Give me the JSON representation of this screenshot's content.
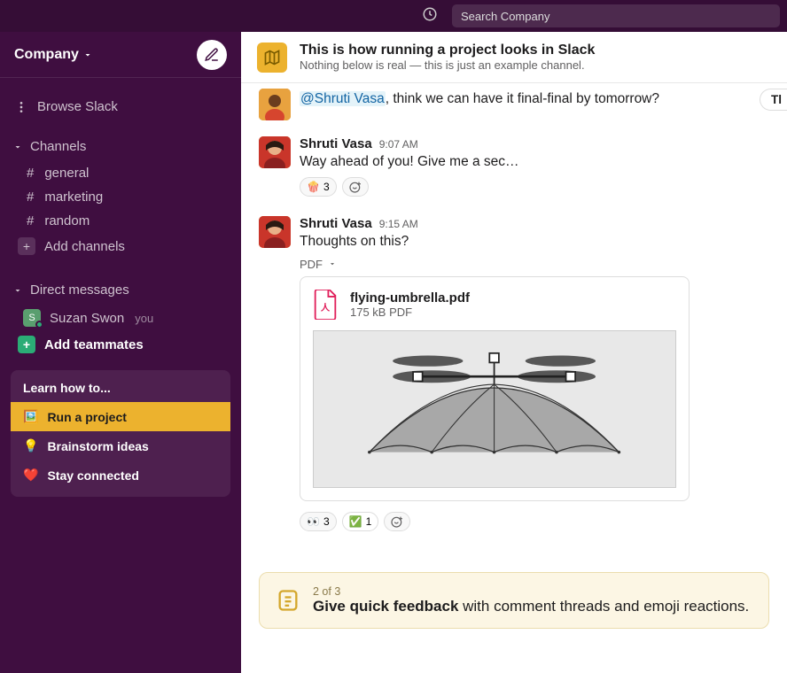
{
  "search": {
    "placeholder": "Search Company"
  },
  "workspace": {
    "name": "Company"
  },
  "sidebar": {
    "browse": "Browse Slack",
    "channels_header": "Channels",
    "channels": [
      "general",
      "marketing",
      "random"
    ],
    "add_channels": "Add channels",
    "dm_header": "Direct messages",
    "dm_user": "Suzan Swon",
    "you": "you",
    "add_teammates": "Add teammates",
    "learn": {
      "title": "Learn how to...",
      "items": [
        "Run a project",
        "Brainstorm ideas",
        "Stay connected"
      ],
      "active_index": 0
    }
  },
  "channel_header": {
    "title": "This is how running a project looks in Slack",
    "subtitle": "Nothing below is real — this is just an example channel."
  },
  "messages": [
    {
      "mention": "@Shruti Vasa",
      "text_after": ", think we can have it final-final by tomorrow?"
    },
    {
      "author": "Shruti Vasa",
      "time": "9:07 AM",
      "text": "Way ahead of you! Give me a sec…",
      "reactions": [
        {
          "emoji": "🍿",
          "count": "3"
        }
      ]
    },
    {
      "author": "Shruti Vasa",
      "time": "9:15 AM",
      "text": "Thoughts on this?",
      "attachment": {
        "label": "PDF",
        "name": "flying-umbrella.pdf",
        "meta": "175 kB PDF"
      },
      "reactions": [
        {
          "emoji": "👀",
          "count": "3"
        },
        {
          "emoji": "✅",
          "count": "1",
          "green": true
        }
      ]
    }
  ],
  "thread_button": "Tl",
  "tip": {
    "step": "2 of 3",
    "title_bold": "Give quick feedback",
    "title_rest": " with comment threads and emoji reactions."
  }
}
